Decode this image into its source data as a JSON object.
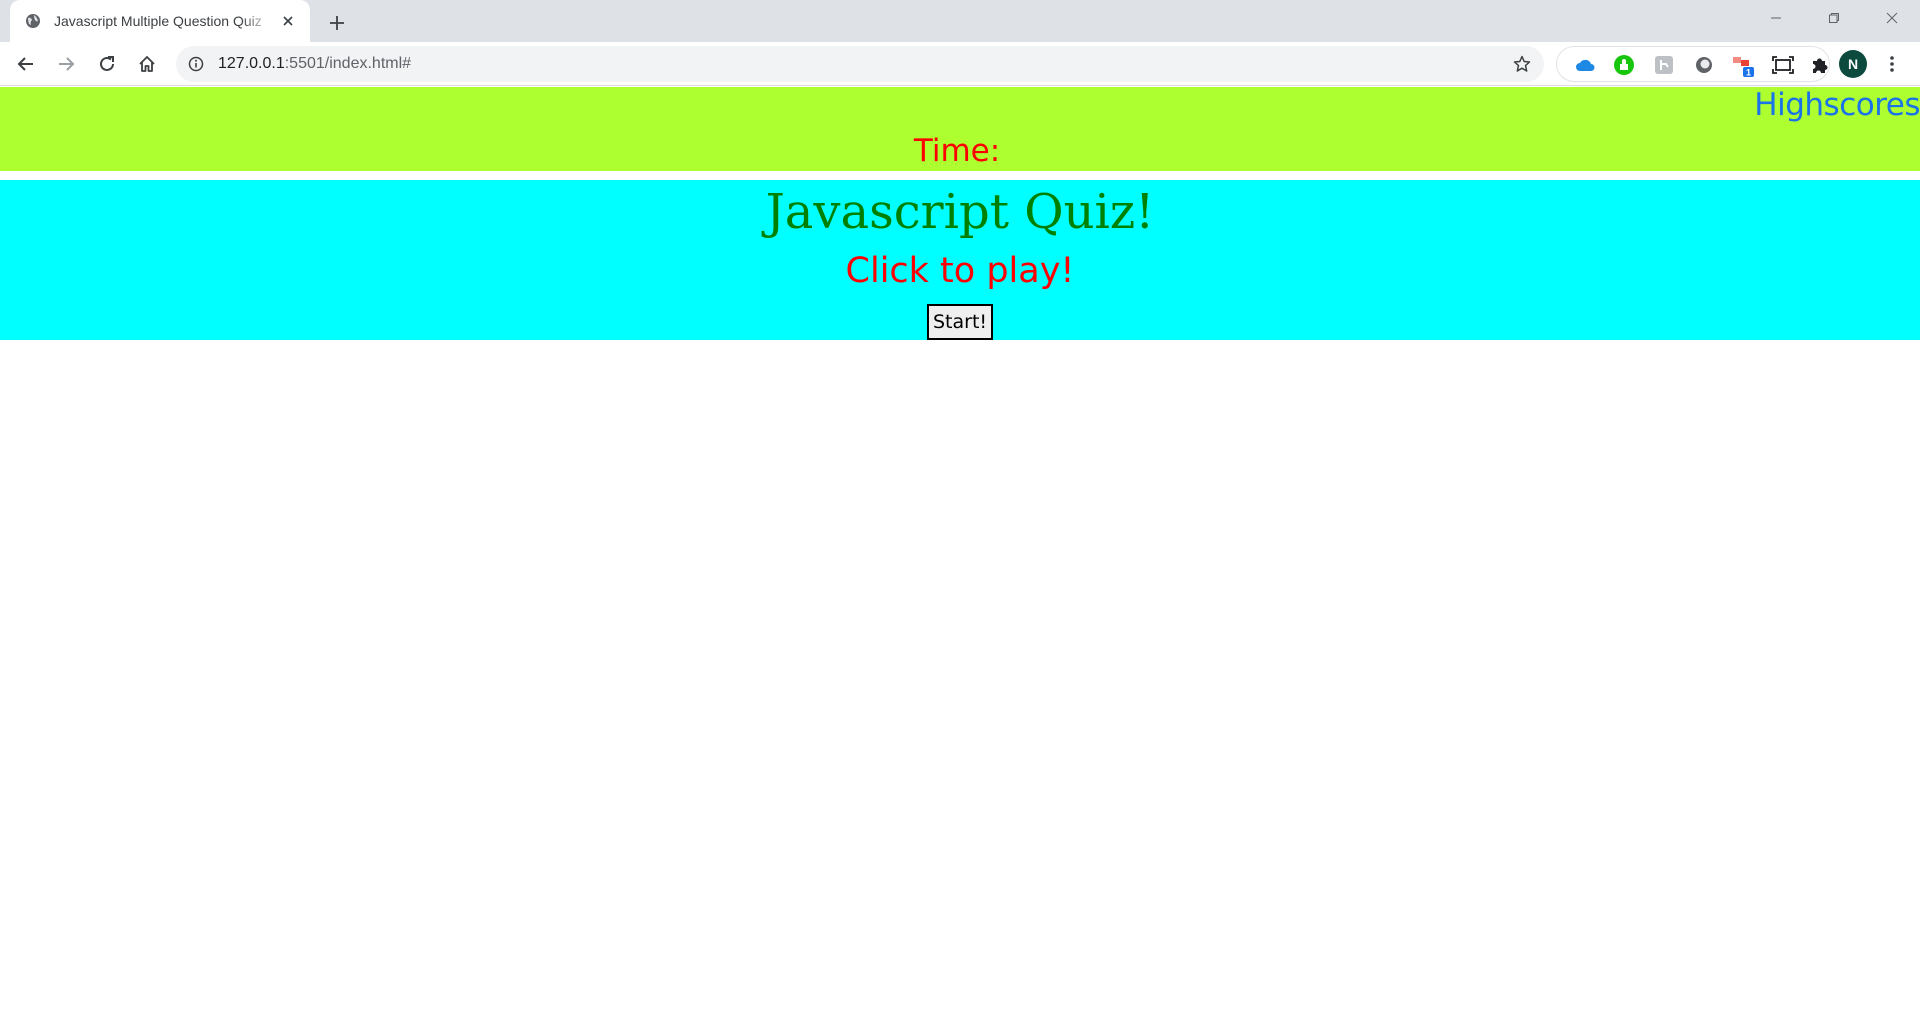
{
  "browser": {
    "tab": {
      "title": "Javascript Multiple Question Quiz"
    },
    "address": {
      "host": "127.0.0.1",
      "rest": ":5501/index.html#"
    },
    "profile": {
      "initial": "N"
    },
    "extensions": [
      {
        "icon": "onedrive-cloud-icon",
        "color": "#1e88e5"
      },
      {
        "icon": "green-puzzle-extension-icon",
        "color": "#16c60c"
      },
      {
        "icon": "gray-extension-icon",
        "color": "#9aa0a6"
      },
      {
        "icon": "circle-extension-icon",
        "color": "#5f6368"
      },
      {
        "icon": "red-extension-icon",
        "color": "#ea4335",
        "badge": "1"
      },
      {
        "icon": "screen-capture-icon",
        "color": "#202124"
      },
      {
        "icon": "extensions-puzzle-icon",
        "color": "#202124"
      }
    ]
  },
  "page": {
    "highscores_label": "Highscores",
    "timer_label": "Time:",
    "timer_value": "",
    "title": "Javascript Quiz!",
    "subtitle": "Click to play!",
    "start_label": "Start!"
  },
  "colors": {
    "header_bg": "#adff2f",
    "intro_bg": "#00ffff",
    "title": "#008000",
    "accent_red": "#ff0000",
    "link_blue": "#1a73e8"
  }
}
